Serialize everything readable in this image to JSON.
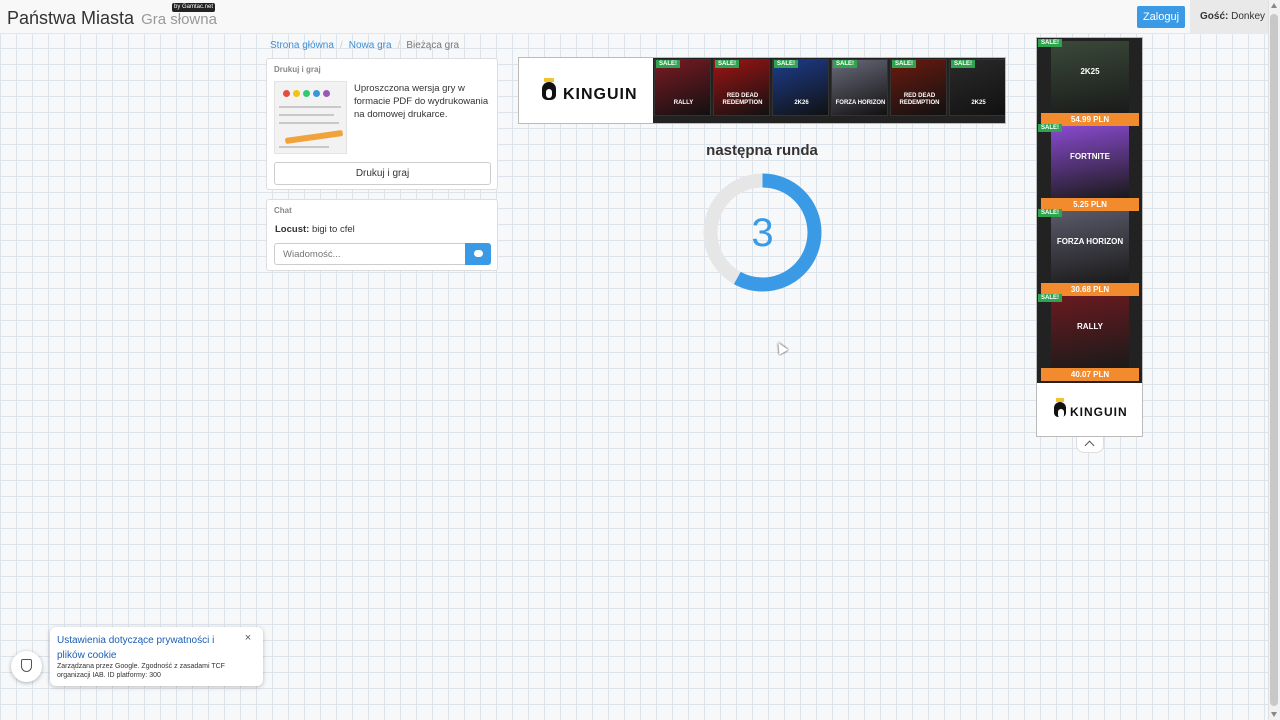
{
  "header": {
    "brand": "Państwa Miasta",
    "subtitle": "Gra słowna",
    "by_badge": "by Gamtac.net",
    "login_button": "Zaloguj",
    "guest_label": "Gość:",
    "guest_name": "Donkey"
  },
  "breadcrumb": {
    "home": "Strona główna",
    "new_game": "Nowa gra",
    "current": "Bieżąca gra"
  },
  "print_panel": {
    "title": "Drukuj i graj",
    "description": "Uproszczona wersja gry w formacie PDF do wydrukowania na domowej drukarce.",
    "button": "Drukuj i graj"
  },
  "chat": {
    "title": "Chat",
    "messages": [
      {
        "author": "Locust:",
        "text": "bigi to cfel"
      }
    ],
    "input_placeholder": "Wiadomość..."
  },
  "game": {
    "round_title": "następna runda",
    "countdown": "3",
    "countdown_fraction": 0.58,
    "accent_color": "#3a9ae6"
  },
  "ad_banner": {
    "brand": "KINGUIN",
    "sale_label": "SALE!",
    "games": [
      {
        "name": "RALLY",
        "color": "#7a1a22"
      },
      {
        "name": "RED DEAD REDEMPTION",
        "color": "#9c1414"
      },
      {
        "name": "2K26",
        "color": "#1c3c8c"
      },
      {
        "name": "FORZA HORIZON",
        "color": "#6a6a7a"
      },
      {
        "name": "RED DEAD REDEMPTION",
        "color": "#6a1a10"
      },
      {
        "name": "2K25",
        "color": "#2a2a2a"
      }
    ]
  },
  "side_ad": {
    "brand": "KINGUIN",
    "sale_label": "SALE!",
    "items": [
      {
        "name": "2K25",
        "price": "54.99 PLN",
        "color": "#3a4a3a"
      },
      {
        "name": "FORTNITE",
        "price": "5.25 PLN",
        "color": "#8a4ad0"
      },
      {
        "name": "FORZA HORIZON",
        "price": "30.68 PLN",
        "color": "#5a5a6a"
      },
      {
        "name": "RALLY",
        "price": "40.07 PLN",
        "color": "#6a1a20"
      }
    ]
  },
  "privacy": {
    "title": "Ustawienia dotyczące prywatności i plików cookie",
    "text": "Zarządzana przez Google. Zgodność z zasadami TCF organizacji IAB. ID platformy: 300",
    "close": "×"
  }
}
